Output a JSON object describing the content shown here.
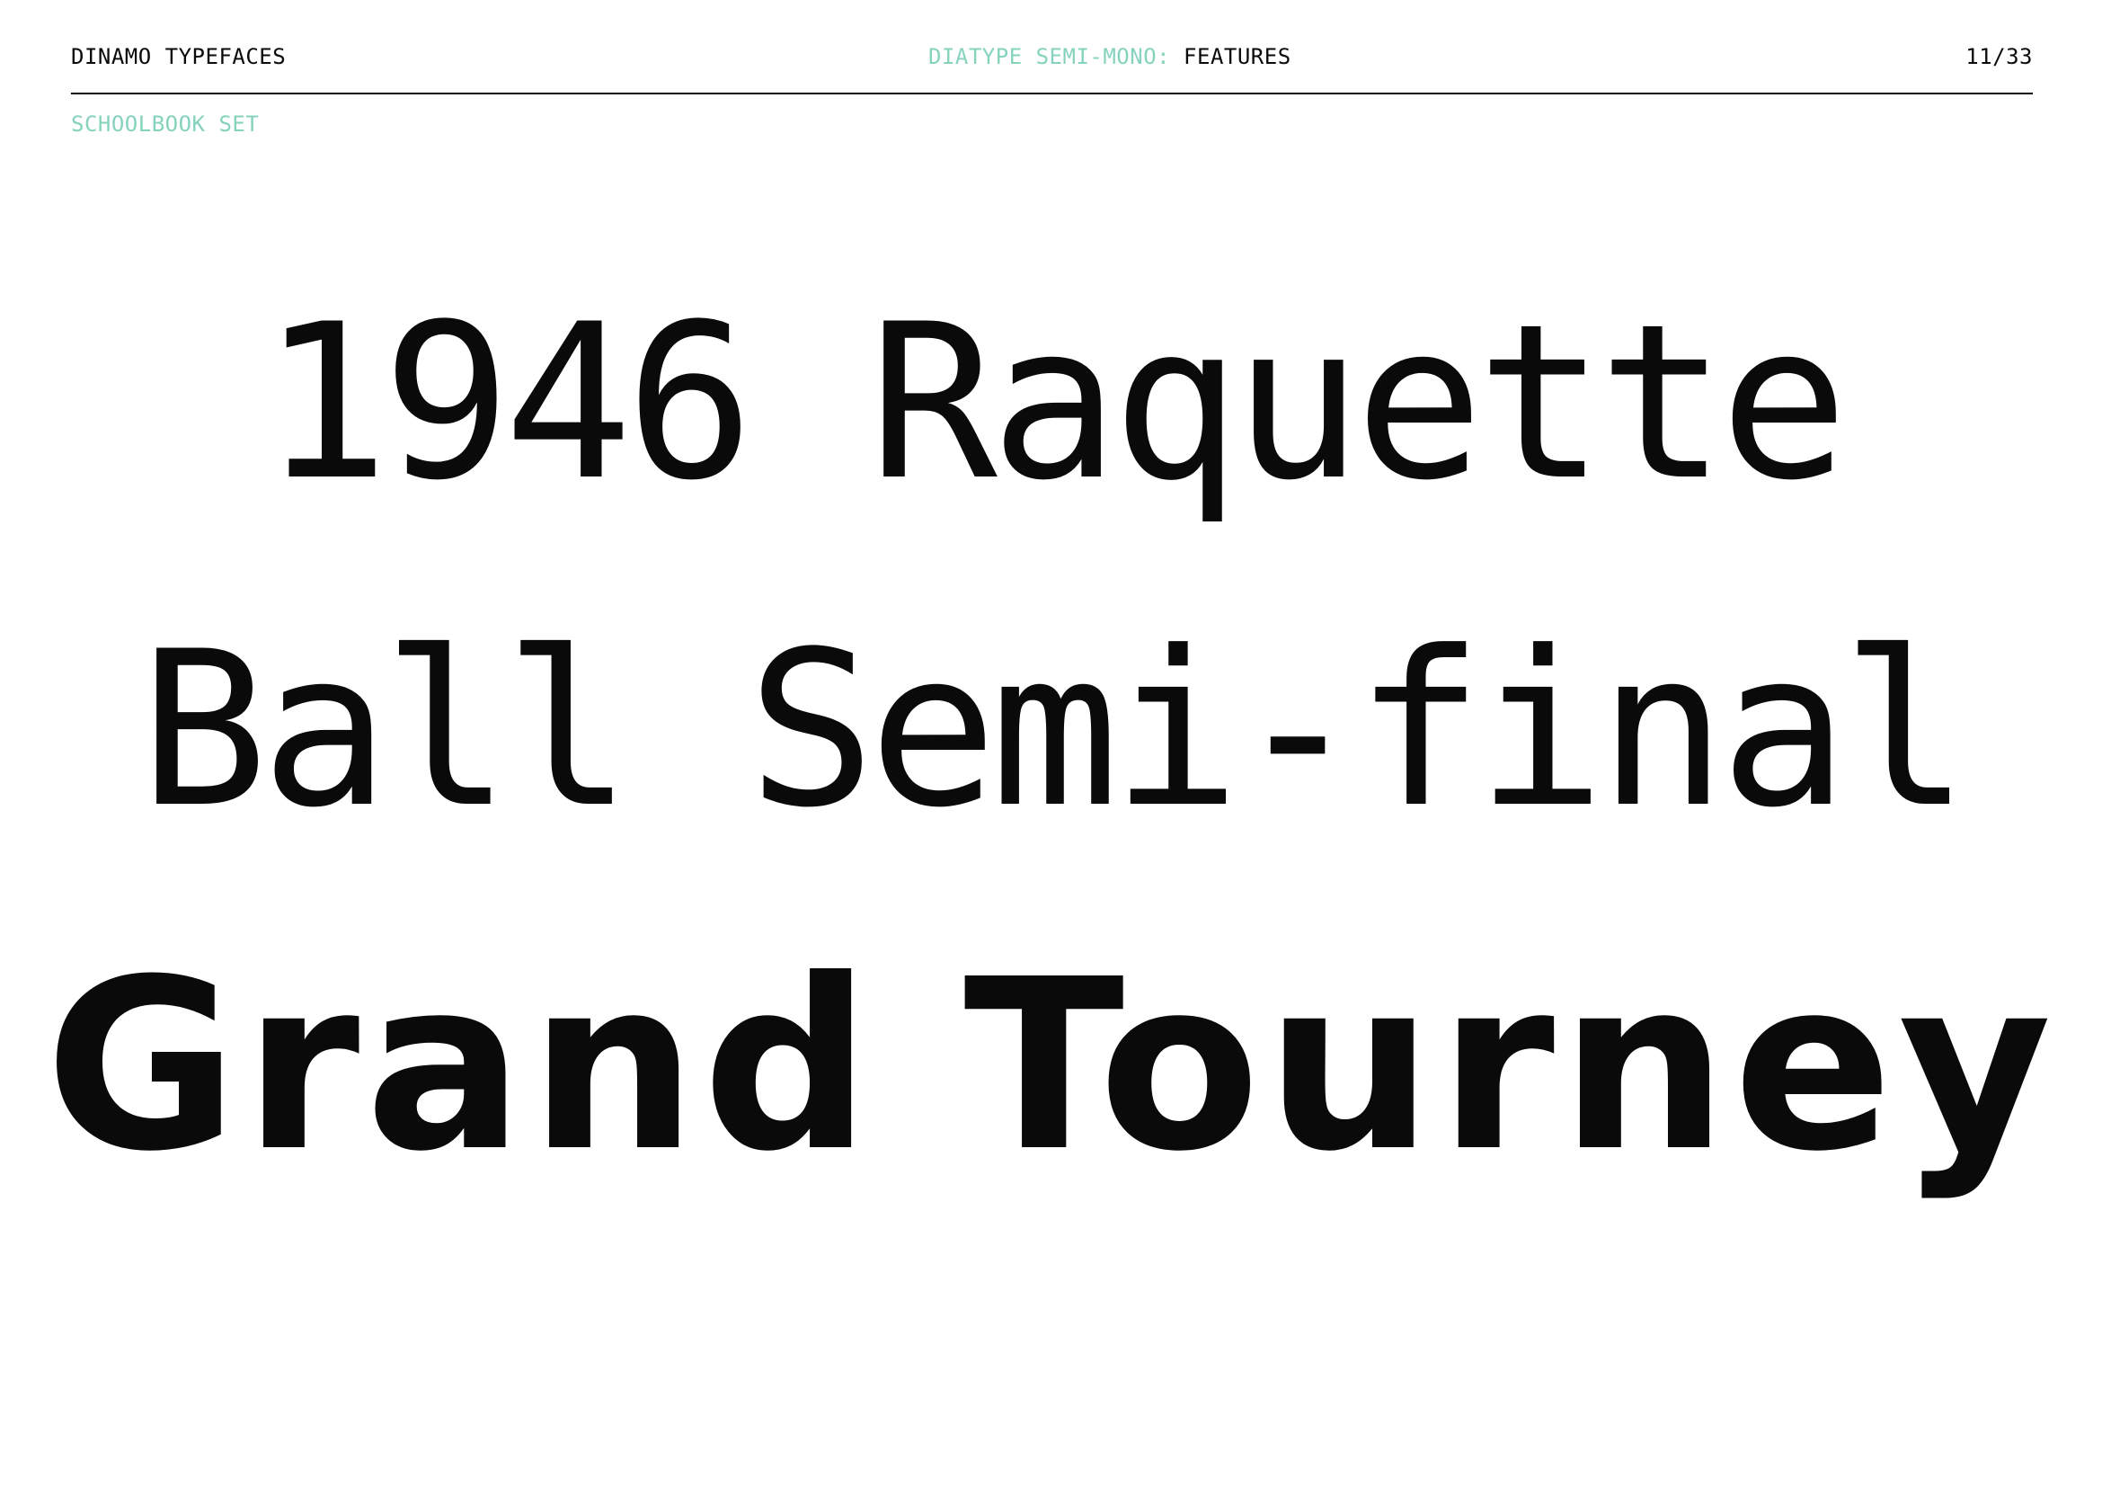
{
  "header": {
    "brand": "DINAMO TYPEFACES",
    "family": "DIATYPE SEMI-MONO:",
    "topic": "FEATURES",
    "page_number": "11/33"
  },
  "section": {
    "label": "SCHOOLBOOK SET"
  },
  "specimen": {
    "lines": [
      "1946 Raquette",
      "Ball Semi-final",
      "Grand Tourney"
    ]
  },
  "colors": {
    "text": "#0a0a0a",
    "accent": "#86d3bd",
    "background": "#ffffff"
  }
}
